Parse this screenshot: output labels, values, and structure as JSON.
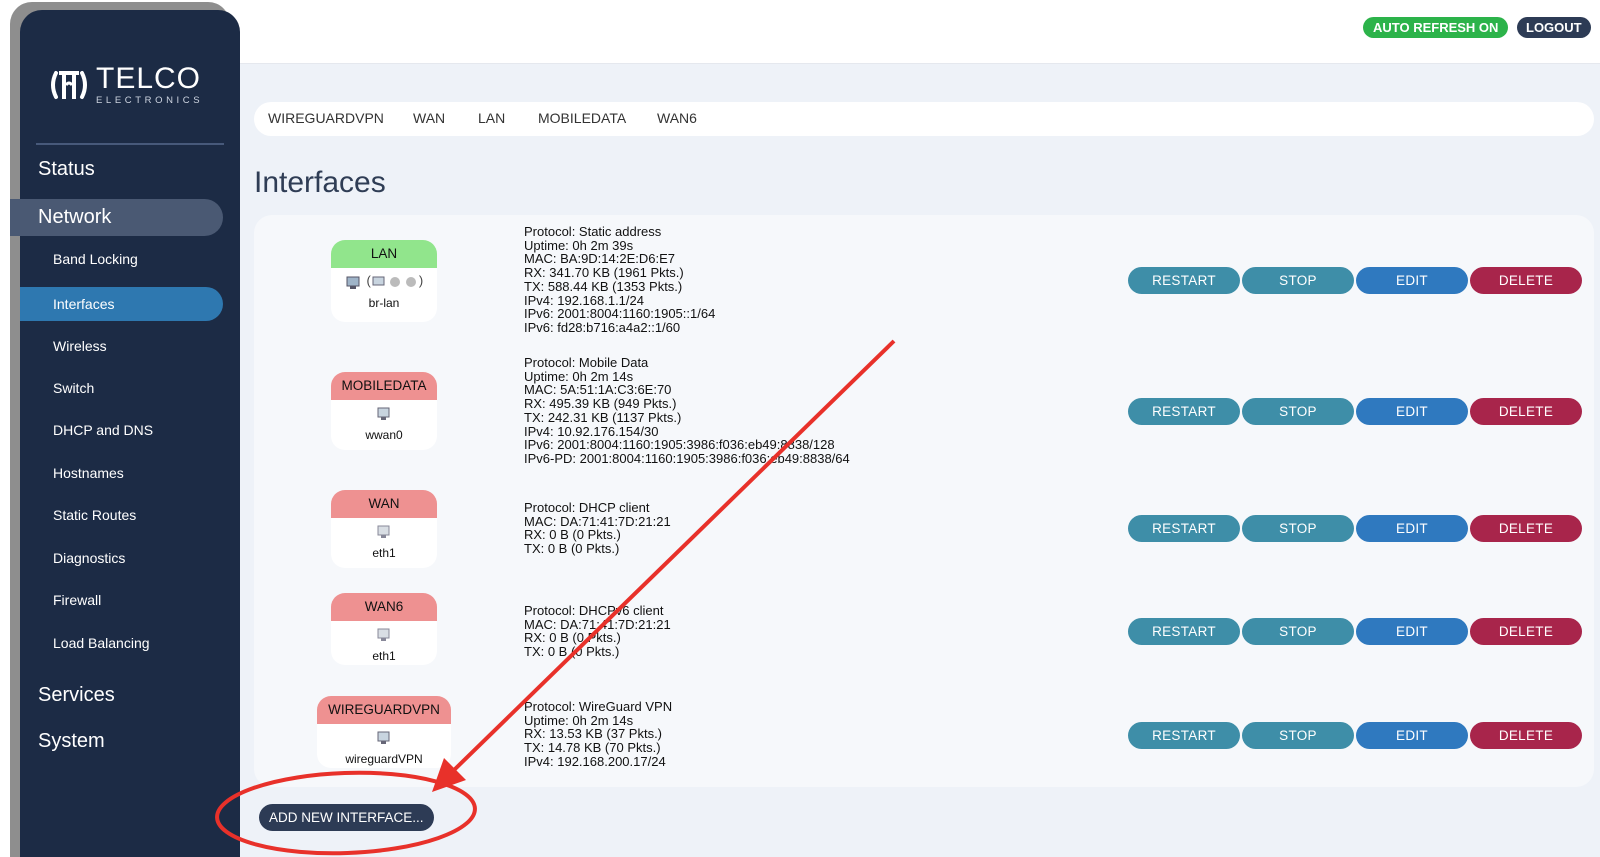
{
  "brand": {
    "name": "TELCO",
    "subtitle": "ELECTRONICS"
  },
  "header": {
    "auto_refresh": "AUTO REFRESH ON",
    "logout": "LOGOUT"
  },
  "nav": {
    "status": "Status",
    "network": "Network",
    "sub": [
      "Band Locking",
      "Interfaces",
      "Wireless",
      "Switch",
      "DHCP and DNS",
      "Hostnames",
      "Static Routes",
      "Diagnostics",
      "Firewall",
      "Load Balancing"
    ],
    "services": "Services",
    "system": "System"
  },
  "tabs": [
    "WIREGUARDVPN",
    "WAN",
    "LAN",
    "MOBILEDATA",
    "WAN6"
  ],
  "page_title": "Interfaces",
  "buttons": {
    "restart": "RESTART",
    "stop": "STOP",
    "edit": "EDIT",
    "delete": "DELETE"
  },
  "add_button": "ADD NEW INTERFACE...",
  "interfaces": [
    {
      "name": "LAN",
      "state": "up",
      "device": "br-lan",
      "icons": "(  )",
      "info": [
        "Protocol: Static address",
        "Uptime: 0h 2m 39s",
        "MAC: BA:9D:14:2E:D6:E7",
        "RX: 341.70 KB (1961 Pkts.)",
        "TX: 588.44 KB (1353 Pkts.)",
        "IPv4: 192.168.1.1/24",
        "IPv6: 2001:8004:1160:1905::1/64",
        "IPv6: fd28:b716:a4a2::1/60"
      ]
    },
    {
      "name": "MOBILEDATA",
      "state": "down",
      "device": "wwan0",
      "info": [
        "Protocol: Mobile Data",
        "Uptime: 0h 2m 14s",
        "MAC: 5A:51:1A:C3:6E:70",
        "RX: 495.39 KB (949 Pkts.)",
        "TX: 242.31 KB (1137 Pkts.)",
        "IPv4: 10.92.176.154/30",
        "IPv6: 2001:8004:1160:1905:3986:f036:eb49:8838/128",
        "IPv6-PD: 2001:8004:1160:1905:3986:f036:eb49:8838/64"
      ]
    },
    {
      "name": "WAN",
      "state": "down",
      "device": "eth1",
      "info": [
        "Protocol: DHCP client",
        "MAC: DA:71:41:7D:21:21",
        "RX: 0 B (0 Pkts.)",
        "TX: 0 B (0 Pkts.)"
      ]
    },
    {
      "name": "WAN6",
      "state": "down",
      "device": "eth1",
      "info": [
        "Protocol: DHCPv6 client",
        "MAC: DA:71:41:7D:21:21",
        "RX: 0 B (0 Pkts.)",
        "TX: 0 B (0 Pkts.)"
      ]
    },
    {
      "name": "WIREGUARDVPN",
      "state": "down",
      "device": "wireguardVPN",
      "info": [
        "Protocol: WireGuard VPN",
        "Uptime: 0h 2m 14s",
        "RX: 13.53 KB (37 Pkts.)",
        "TX: 14.78 KB (70 Pkts.)",
        "IPv4: 192.168.200.17/24"
      ]
    }
  ],
  "colors": {
    "up": "#91e58c",
    "down": "#ee9191",
    "annotation": "#e8312a",
    "sidebar": "#1c2b45"
  }
}
